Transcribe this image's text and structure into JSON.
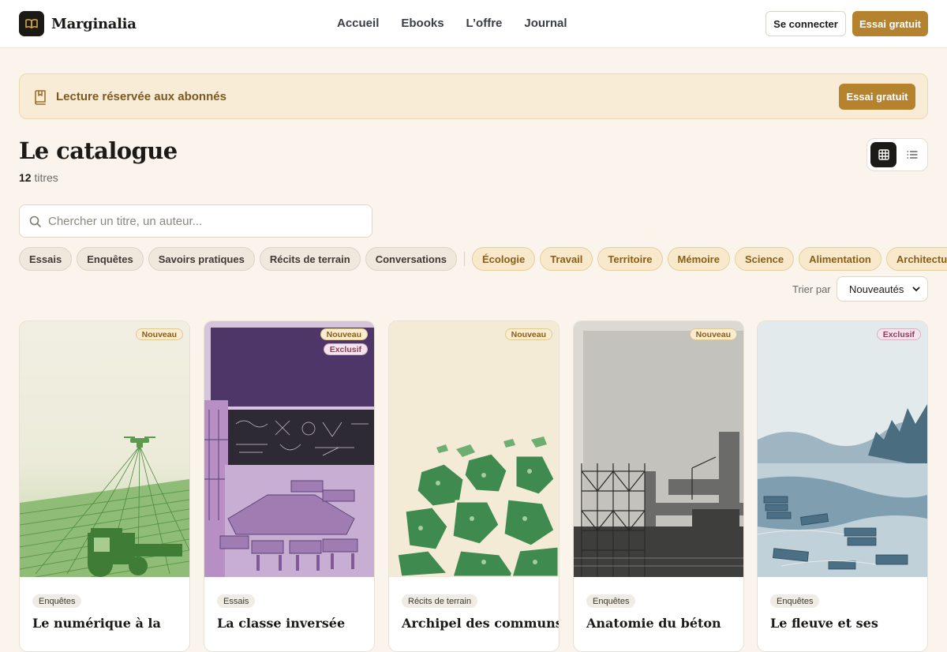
{
  "brand": {
    "name": "Marginalia"
  },
  "nav": [
    "Accueil",
    "Ebooks",
    "L’offre",
    "Journal"
  ],
  "header": {
    "login_label": "Se connecter",
    "trial_label": "Essai gratuit"
  },
  "banner": {
    "text": "Lecture réservée aux abonnés",
    "button_label": "Essai gratuit"
  },
  "catalog": {
    "title": "Le catalogue",
    "count": "12",
    "count_suffix": " titres"
  },
  "search": {
    "placeholder": "Chercher un titre, un auteur..."
  },
  "filters": {
    "formats": [
      "Essais",
      "Enquêtes",
      "Savoirs pratiques",
      "Récits de terrain",
      "Conversations"
    ],
    "themes": [
      "Écologie",
      "Travail",
      "Territoire",
      "Mémoire",
      "Science",
      "Alimentation",
      "Architecture"
    ]
  },
  "sort": {
    "label": "Trier par",
    "selected": "Nouveautés"
  },
  "cards": [
    {
      "title": "Le numérique à la",
      "tag": "Enquêtes",
      "badges": [
        "Nouveau"
      ]
    },
    {
      "title": "La classe inversée",
      "tag": "Essais",
      "badges": [
        "Nouveau",
        "Exclusif"
      ]
    },
    {
      "title": "Archipel des communs",
      "tag": "Récits de terrain",
      "badges": [
        "Nouveau"
      ]
    },
    {
      "title": "Anatomie du béton",
      "tag": "Enquêtes",
      "badges": [
        "Nouveau"
      ]
    },
    {
      "title": "Le fleuve et ses",
      "tag": "Enquêtes",
      "badges": [
        "Exclusif"
      ]
    }
  ],
  "colors": {
    "accent": "#b5832e",
    "background": "#faf4ec",
    "banner": "#f8ecd6",
    "dark": "#1b1a17"
  },
  "icons": [
    "book-icon",
    "book-bookmark-icon",
    "grid-view-icon",
    "list-view-icon",
    "search-icon",
    "chevron-down-icon"
  ]
}
